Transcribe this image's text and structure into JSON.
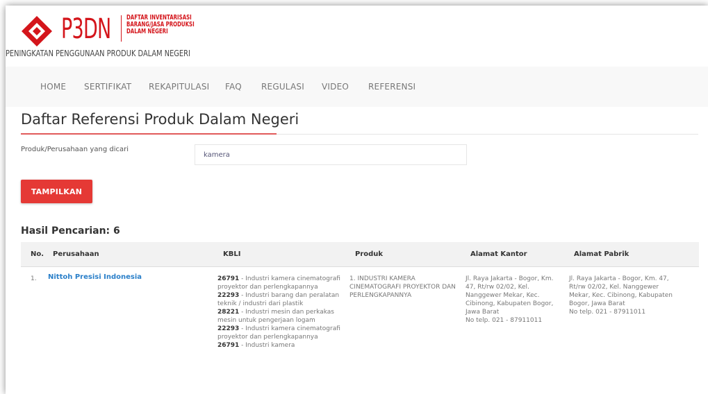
{
  "header": {
    "brand": "P3DN",
    "brand_sub": [
      "DAFTAR INVENTARISASI",
      "BARANG/JASA PRODUKSI",
      "DALAM NEGERI"
    ],
    "tagline": "PENINGKATAN PENGGUNAAN PRODUK DALAM NEGERI",
    "brand_color": "#d4151b"
  },
  "nav": {
    "items": [
      {
        "label": "HOME"
      },
      {
        "label": "SERTIFIKAT"
      },
      {
        "label": "REKAPITULASI"
      },
      {
        "label": "FAQ"
      },
      {
        "label": "REGULASI"
      },
      {
        "label": "VIDEO"
      },
      {
        "label": "REFERENSI"
      }
    ]
  },
  "page": {
    "title": "Daftar Referensi Produk Dalam Negeri"
  },
  "search": {
    "label": "Produk/Perusahaan yang dicari",
    "value": "kamera",
    "button_label": "TAMPILKAN",
    "button_color": "#e53935"
  },
  "results": {
    "title": "Hasil Pencarian: 6",
    "columns": [
      "No.",
      "Perusahaan",
      "KBLI",
      "Produk",
      "Alamat Kantor",
      "Alamat Pabrik"
    ],
    "rows": [
      {
        "no": "1.",
        "company": "Nittoh Presisi Indonesia",
        "kbli": [
          {
            "code": "26791",
            "desc": " - Industri kamera cinematografi proyektor dan perlengkapannya"
          },
          {
            "code": "22293",
            "desc": " - Industri barang dan peralatan teknik / industri dari plastik"
          },
          {
            "code": "28221",
            "desc": " - Industri mesin dan perkakas mesin untuk pengerjaan logam"
          },
          {
            "code": "22293",
            "desc": " - Industri kamera cinematografi proyektor dan perlengkapannya"
          },
          {
            "code": "26791",
            "desc": " - Industri kamera"
          }
        ],
        "product": "1. INDUSTRI KAMERA CINEMATOGRAFI PROYEKTOR DAN PERLENGKAPANNYA",
        "office_address": "Jl. Raya Jakarta - Bogor, Km. 47, Rt/rw 02/02, Kel. Nanggewer Mekar, Kec. Cibinong, Kabupaten Bogor, Jawa Barat",
        "office_phone": "No telp. 021 - 87911011",
        "factory_address": "Jl. Raya Jakarta - Bogor, Km. 47, Rt/rw 02/02, Kel. Nanggewer Mekar, Kec. Cibinong, Kabupaten Bogor, Jawa Barat",
        "factory_phone": "No telp. 021 - 87911011"
      }
    ]
  }
}
